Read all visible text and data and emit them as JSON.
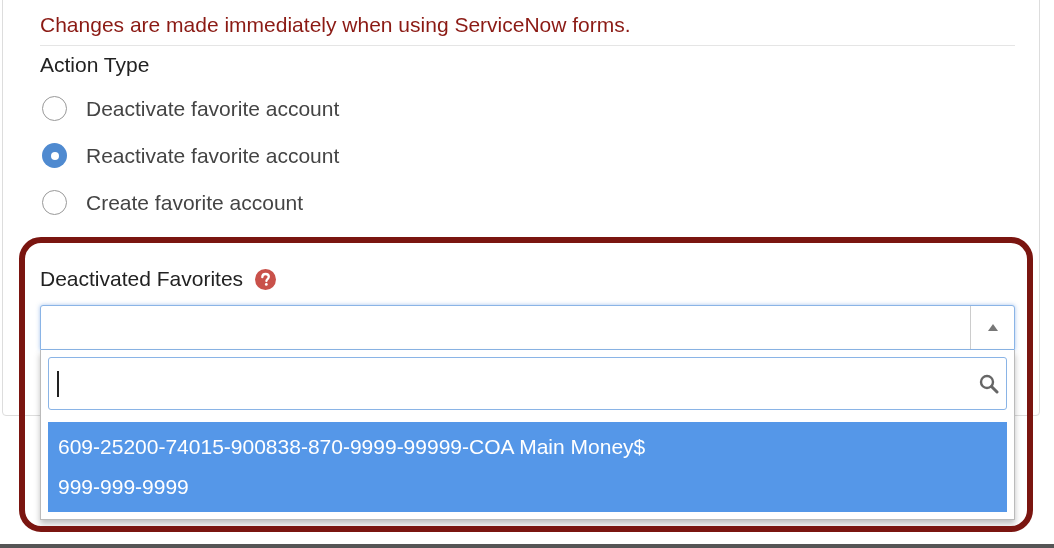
{
  "notice": "Changes are made immediately when using ServiceNow forms.",
  "action_type": {
    "label": "Action Type",
    "options": [
      {
        "label": "Deactivate favorite account",
        "selected": false
      },
      {
        "label": "Reactivate favorite account",
        "selected": true
      },
      {
        "label": "Create favorite account",
        "selected": false
      }
    ]
  },
  "deactivated_favorites": {
    "label": "Deactivated Favorites",
    "expanded": true,
    "options": [
      {
        "lines": [
          "609-25200-74015-900838-870-9999-99999-COA Main Money$",
          "999-999-9999"
        ],
        "selected": true
      }
    ]
  }
}
